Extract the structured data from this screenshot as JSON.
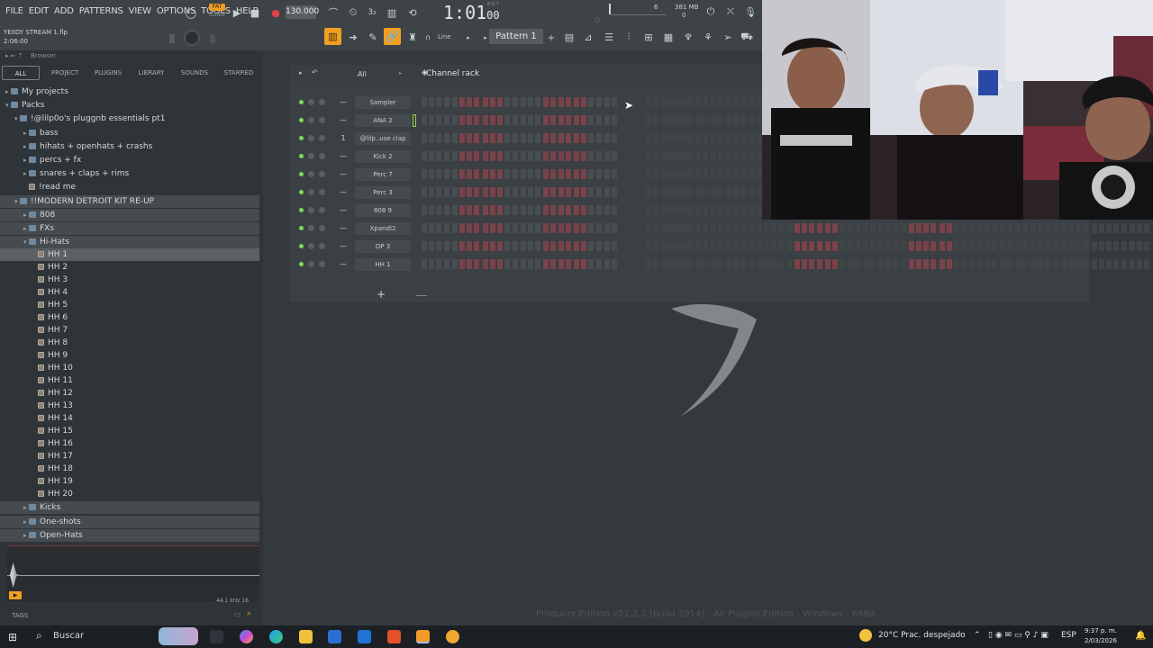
{
  "menu": [
    "FILE",
    "EDIT",
    "ADD",
    "PATTERNS",
    "VIEW",
    "OPTIONS",
    "TOOLS",
    "HELP"
  ],
  "transport": {
    "tempo": "130.000",
    "pat_song_label": "PAT",
    "song_label": "SONG",
    "time": "1:01",
    "time_ticks": "00",
    "bst_label": "B:S:T",
    "memory": "381 MB",
    "cpu_top": "6",
    "cpu_bottom": "0"
  },
  "project": {
    "name": "YEIIDY STREAM 1.flp",
    "duration": "2:06:00"
  },
  "toolbar": {
    "snap": "Line",
    "pattern": "Pattern 1"
  },
  "browser": {
    "title": "Browser",
    "tabs": [
      "ALL",
      "PROJECT",
      "PLUGINS",
      "LIBRARY",
      "SOUNDS",
      "STARRED"
    ],
    "tree": [
      {
        "label": "My projects",
        "indent": 0,
        "type": "folder"
      },
      {
        "label": "Packs",
        "indent": 0,
        "type": "folder",
        "open": true
      },
      {
        "label": "!@lilp0o's pluggnb essentials pt1",
        "indent": 1,
        "type": "folder",
        "open": true
      },
      {
        "label": "bass",
        "indent": 2,
        "type": "folder"
      },
      {
        "label": "hihats + openhats + crashs",
        "indent": 2,
        "type": "folder"
      },
      {
        "label": "percs + fx",
        "indent": 2,
        "type": "folder"
      },
      {
        "label": "snares + claps + rims",
        "indent": 2,
        "type": "folder"
      },
      {
        "label": "!read me",
        "indent": 2,
        "type": "file"
      },
      {
        "label": "!!MODERN DETROIT KIT RE-UP",
        "indent": 1,
        "type": "folder",
        "open": true
      },
      {
        "label": "808",
        "indent": 2,
        "type": "folder"
      },
      {
        "label": "FXs",
        "indent": 2,
        "type": "folder"
      },
      {
        "label": "Hi-Hats",
        "indent": 2,
        "type": "folder",
        "open": true
      }
    ],
    "hihats": [
      "HH 1",
      "HH 2",
      "HH 3",
      "HH 4",
      "HH 5",
      "HH 6",
      "HH 7",
      "HH 8",
      "HH 9",
      "HH 10",
      "HH 11",
      "HH 12",
      "HH 13",
      "HH 14",
      "HH 15",
      "HH 16",
      "HH 17",
      "HH 18",
      "HH 19",
      "HH 20"
    ],
    "after": [
      "Kicks",
      "One-shots",
      "Open-Hats"
    ],
    "sample_rate": "44.1 kHz 16",
    "tags_label": "TAGS"
  },
  "channel_rack": {
    "title": "Channel rack",
    "filter": "All",
    "channels": [
      {
        "name": "Sampler",
        "num": "—"
      },
      {
        "name": "ANA 2",
        "num": "—"
      },
      {
        "name": "@lilp..use clap",
        "num": "1"
      },
      {
        "name": "Kick 2",
        "num": "—"
      },
      {
        "name": "Perc 7",
        "num": "—"
      },
      {
        "name": "Perc 3",
        "num": "—"
      },
      {
        "name": "808 9",
        "num": "—"
      },
      {
        "name": "Xpandl2",
        "num": "—"
      },
      {
        "name": "OP 3",
        "num": "—"
      },
      {
        "name": "HH 1",
        "num": "—"
      }
    ],
    "add_label": "+"
  },
  "status": {
    "edition": "Producer Edition v21.2.2 [build 3914] - All Plugins Edition - Windows - 64Bit"
  },
  "taskbar": {
    "search": "Buscar",
    "weather": "20°C  Prac. despejado",
    "lang": "ESP",
    "time": "9:37 p. m.",
    "date": "2/03/2026"
  },
  "colors": {
    "accent": "#f0a020",
    "record": "#e0404a",
    "step_active": "#7a4249"
  }
}
